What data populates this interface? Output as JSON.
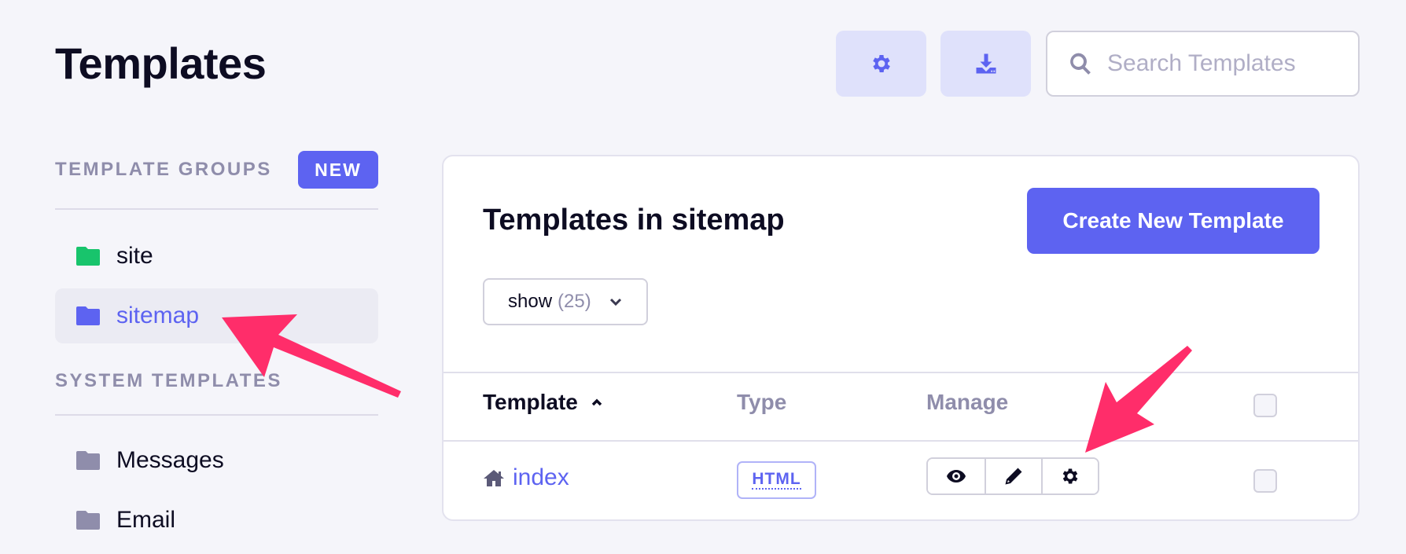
{
  "page": {
    "title": "Templates"
  },
  "toolbar": {
    "settings_icon": "gear-icon",
    "export_icon": "download-icon",
    "search_placeholder": "Search Templates",
    "search_value": ""
  },
  "sidebar": {
    "groups_heading": "TEMPLATE GROUPS",
    "new_button": "NEW",
    "groups": [
      {
        "label": "site",
        "icon": "folder-icon",
        "color": "#18c46c",
        "active": false
      },
      {
        "label": "sitemap",
        "icon": "folder-icon",
        "color": "#5d63f1",
        "active": true
      }
    ],
    "system_heading": "SYSTEM TEMPLATES",
    "system": [
      {
        "label": "Messages",
        "icon": "folder-icon",
        "color": "#8f8dab"
      },
      {
        "label": "Email",
        "icon": "folder-icon",
        "color": "#8f8dab"
      }
    ]
  },
  "main": {
    "title": "Templates in sitemap",
    "create_button": "Create New Template",
    "show_select": {
      "label": "show",
      "count": "(25)"
    },
    "table": {
      "columns": [
        {
          "label": "Template",
          "sorted": "asc"
        },
        {
          "label": "Type"
        },
        {
          "label": "Manage"
        }
      ],
      "rows": [
        {
          "name": "index",
          "icon": "home-icon",
          "type": "HTML",
          "actions": [
            "view",
            "edit",
            "settings"
          ],
          "selected": false
        }
      ]
    }
  },
  "colors": {
    "accent": "#5d63f1",
    "annotation_arrow": "#ff2d6a",
    "muted_text": "#8f8dab"
  }
}
